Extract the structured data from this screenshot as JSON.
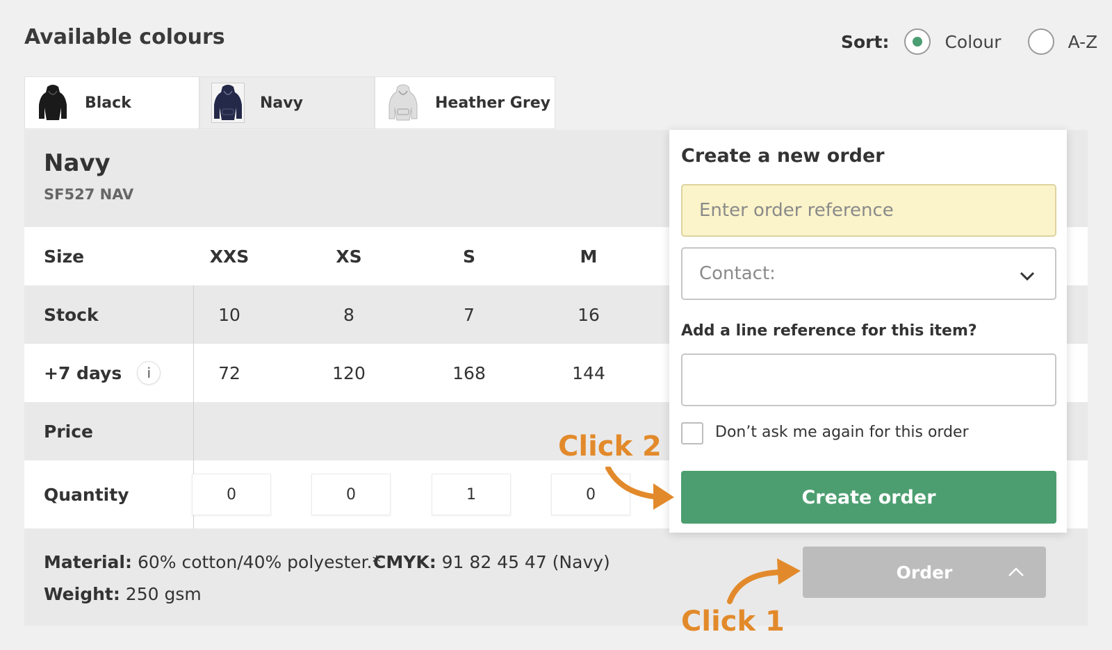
{
  "header": {
    "title": "Available colours",
    "sort_label": "Sort:",
    "sort_options": [
      {
        "label": "Colour",
        "selected": true
      },
      {
        "label": "A-Z",
        "selected": false
      }
    ]
  },
  "colour_tabs": [
    {
      "label": "Black",
      "color": "#1a1a1a",
      "icon": "hoodie-icon",
      "active": false
    },
    {
      "label": "Navy",
      "color": "#24294a",
      "icon": "hoodie-icon",
      "active": true
    },
    {
      "label": "Heather Grey",
      "color": "#d2d2d2",
      "icon": "hoodie-icon",
      "active": false
    }
  ],
  "product": {
    "name": "Navy",
    "code": "SF527 NAV"
  },
  "table": {
    "size_label": "Size",
    "sizes": [
      "XXS",
      "XS",
      "S",
      "M"
    ],
    "stock_label": "Stock",
    "stock": [
      "10",
      "8",
      "7",
      "16"
    ],
    "days_label": "+7 days",
    "days_info_icon": "i",
    "days": [
      "72",
      "120",
      "168",
      "144"
    ],
    "price_label": "Price",
    "quantity_label": "Quantity",
    "quantities": [
      "0",
      "0",
      "1",
      "0"
    ]
  },
  "meta": {
    "material_label": "Material:",
    "material_value": " 60% cotton/40% polyester.*",
    "cmyk_label": "CMYK:",
    "cmyk_value": " 91 82 45 47 (Navy)",
    "weight_label": "Weight:",
    "weight_value": " 250 gsm"
  },
  "order_button": {
    "label": "Order",
    "icon": "chevron-up-icon"
  },
  "popup": {
    "title": "Create a new order",
    "reference_placeholder": "Enter order reference",
    "contact_label": "Contact:",
    "line_reference_label": "Add a line reference for this item?",
    "line_reference_value": "",
    "dont_ask_label": "Don’t ask me again for this order",
    "create_button": "Create order"
  },
  "annotations": {
    "click1": "Click 1",
    "click2": "Click 2",
    "color": "#e28a2b"
  },
  "colors": {
    "accent_green": "#4c9e70",
    "order_button_grey": "#bcbcbc",
    "reference_field_bg": "#fbf3c9"
  }
}
